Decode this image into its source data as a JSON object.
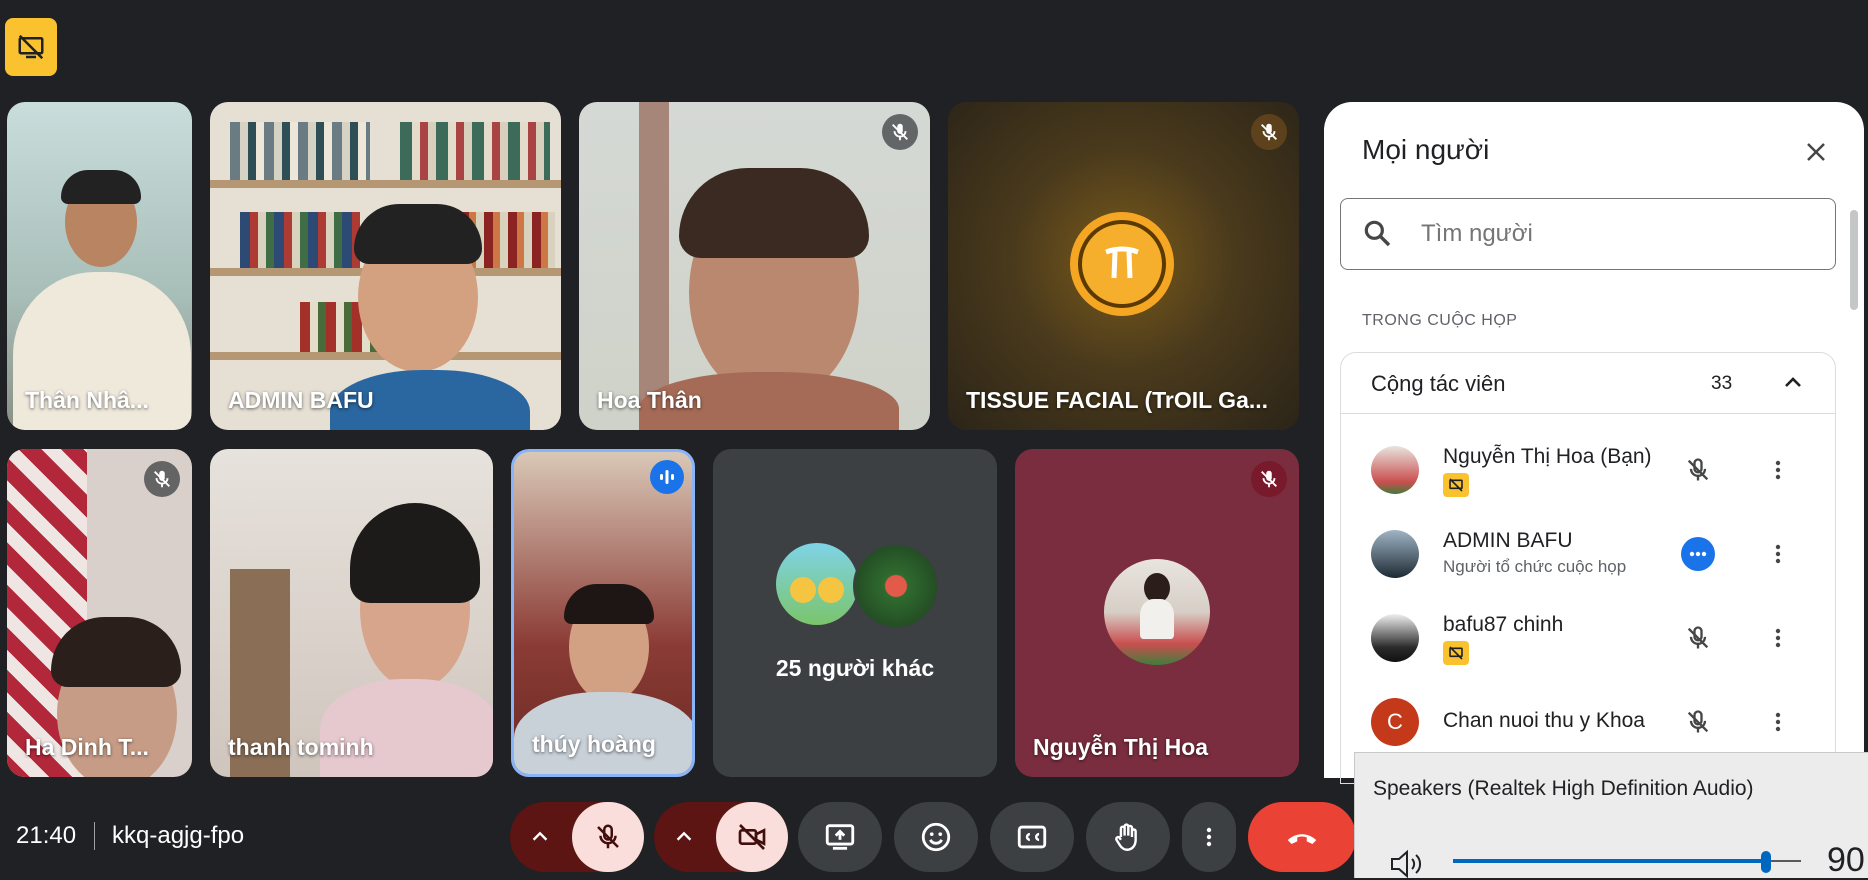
{
  "meeting": {
    "time": "21:40",
    "code": "kkq-agjg-fpo"
  },
  "tiles": [
    {
      "name": "Thân Nhâ...",
      "muted": false
    },
    {
      "name": "ADMIN BAFU",
      "muted": false
    },
    {
      "name": "Hoa Thân",
      "muted": true
    },
    {
      "name": "TISSUE FACIAL (TrOIL Ga...",
      "muted": true
    },
    {
      "name": "Ha Dinh T...",
      "muted": true
    },
    {
      "name": "thanh tominh",
      "muted": false
    },
    {
      "name": "thúy hoàng",
      "speaking": true
    },
    {
      "name": "25 người khác"
    },
    {
      "name": "Nguyễn Thị Hoa",
      "muted": true
    }
  ],
  "panel": {
    "title": "Mọi người",
    "search_placeholder": "Tìm người",
    "section_label": "TRONG CUỘC HỌP",
    "group": {
      "title": "Cộng tác viên",
      "count": "33"
    },
    "participants": [
      {
        "name": "Nguyễn Thị Hoa (Bạn)",
        "sub": "",
        "badge": true,
        "status": "mic-off"
      },
      {
        "name": "ADMIN BAFU",
        "sub": "Người tổ chức cuộc họp",
        "badge": false,
        "status": "more-active"
      },
      {
        "name": "bafu87 chinh",
        "sub": "",
        "badge": true,
        "status": "mic-off"
      },
      {
        "name": "Chan nuoi thu y Khoa",
        "sub": "",
        "badge": false,
        "status": "mic-off",
        "initial": "C"
      }
    ]
  },
  "speakers_popup": {
    "title": "Speakers (Realtek High Definition Audio)",
    "level": "90",
    "level_fraction": 0.9
  },
  "colors": {
    "accent_blue": "#1a73e8",
    "end_call": "#ea4335",
    "badge_yellow": "#f9c22e"
  }
}
